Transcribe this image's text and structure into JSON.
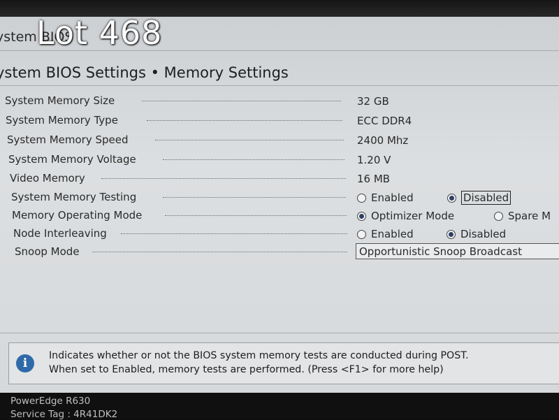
{
  "overlay": {
    "lot_label": "Lot 468"
  },
  "window": {
    "title": "ystem BIOS"
  },
  "page": {
    "heading": "ystem BIOS Settings • Memory Settings"
  },
  "rows": [
    {
      "label": "System Memory Size",
      "value": "32 GB"
    },
    {
      "label": "System Memory Type",
      "value": "ECC DDR4"
    },
    {
      "label": "System Memory Speed",
      "value": "2400 Mhz"
    },
    {
      "label": "System Memory Voltage",
      "value": "1.20 V"
    },
    {
      "label": "Video Memory",
      "value": "16 MB"
    },
    {
      "label": "System Memory Testing",
      "options": [
        "Enabled",
        "Disabled"
      ],
      "selected": "Disabled"
    },
    {
      "label": "Memory Operating Mode",
      "options": [
        "Optimizer Mode",
        "Spare M"
      ],
      "selected": "Optimizer Mode"
    },
    {
      "label": "Node Interleaving",
      "options": [
        "Enabled",
        "Disabled"
      ],
      "selected": "Disabled"
    },
    {
      "label": "Snoop Mode",
      "value": "Opportunistic Snoop Broadcast"
    }
  ],
  "help": {
    "line1": "Indicates whether or not the BIOS system memory tests are conducted during POST.",
    "line2": "When set to Enabled, memory tests are performed. (Press <F1> for more help)"
  },
  "footer": {
    "model": "PowerEdge R630",
    "service_tag": "Service Tag : 4R41DK2"
  },
  "colors": {
    "info_icon": "#2f6aa8",
    "radio_selected": "#2c3f66",
    "screen_bg": "#dcdfe1"
  }
}
